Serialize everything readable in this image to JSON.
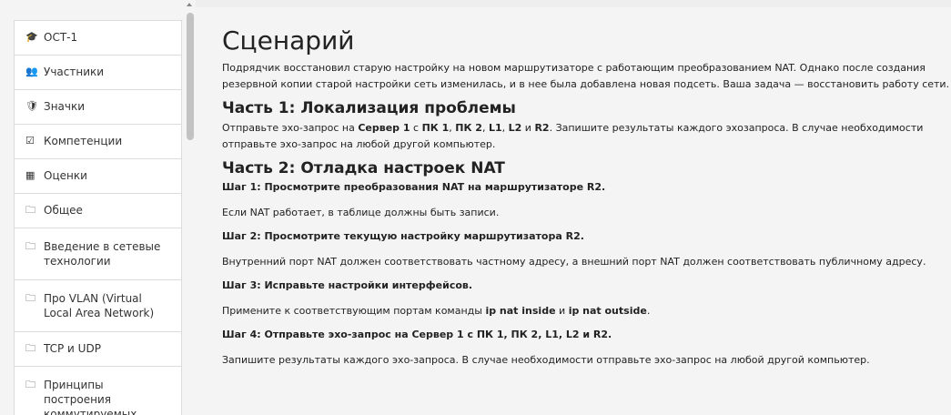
{
  "sidebar": {
    "items": [
      {
        "icon": "graduation-cap-icon",
        "glyph": "🎓",
        "label": "ОСТ-1"
      },
      {
        "icon": "users-icon",
        "glyph": "👥",
        "label": "Участники"
      },
      {
        "icon": "shield-icon",
        "glyph": "🛡",
        "label": "Значки"
      },
      {
        "icon": "check-square-icon",
        "glyph": "☑",
        "label": "Компетенции"
      },
      {
        "icon": "table-icon",
        "glyph": "▦",
        "label": "Оценки"
      },
      {
        "icon": "folder-icon",
        "glyph": "🗀",
        "label": "Общее"
      },
      {
        "icon": "folder-icon",
        "glyph": "🗀",
        "label": "Введение в сетевые технологии"
      },
      {
        "icon": "folder-icon",
        "glyph": "🗀",
        "label": "Про VLAN (Virtual Local Area Network)"
      },
      {
        "icon": "folder-icon",
        "glyph": "🗀",
        "label": "TCP и UDP"
      },
      {
        "icon": "folder-icon",
        "glyph": "🗀",
        "label": "Принципы построения коммутируемых"
      }
    ]
  },
  "content": {
    "title": "Сценарий",
    "intro": "Подрядчик восстановил старую настройку на новом маршрутизаторе с работающим преобразованием NAT. Однако после создания резервной копии старой настройки сеть изменилась, и в нее была добавлена новая подсеть. Ваша задача — восстановить работу сети.",
    "part1": {
      "heading": "Часть 1: Локализация проблемы",
      "text_a": "Отправьте эхо-запрос на ",
      "b1": "Сервер 1",
      "text_b": " с ",
      "b2": "ПК 1",
      "sep1": ", ",
      "b3": "ПК 2",
      "sep2": ", ",
      "b4": "L1",
      "sep3": ", ",
      "b5": "L2",
      "text_c": " и ",
      "b6": "R2",
      "text_d": ". Запишите результаты каждого эхозапроса. В случае необходимости отправьте эхо-запрос на любой другой компьютер."
    },
    "part2": {
      "heading": "Часть 2: Отладка настроек NAT",
      "step1": "Шаг 1: Просмотрите преобразования NAT на маршрутизаторе R2.",
      "step1_text": "Если NAT работает, в таблице должны быть записи.",
      "step2": "Шаг 2: Просмотрите текущую настройку маршрутизатора R2.",
      "step2_text": "Внутренний порт NAT должен соответствовать частному адресу, а внешний порт NAT должен соответствовать публичному адресу.",
      "step3": "Шаг 3: Исправьте настройки интерфейсов.",
      "step3_text_a": "Примените к соответствующим портам команды ",
      "step3_cmd1": "ip nat inside",
      "step3_text_b": " и ",
      "step3_cmd2": "ip nat outside",
      "step3_text_c": ".",
      "step4": "Шаг 4: Отправьте эхо-запрос на Сервер 1 с ПК 1, ПК 2, L1, L2 и R2.",
      "step4_text": "Запишите результаты каждого эхо-запроса. В случае необходимости отправьте эхо-запрос на любой другой компьютер."
    }
  }
}
